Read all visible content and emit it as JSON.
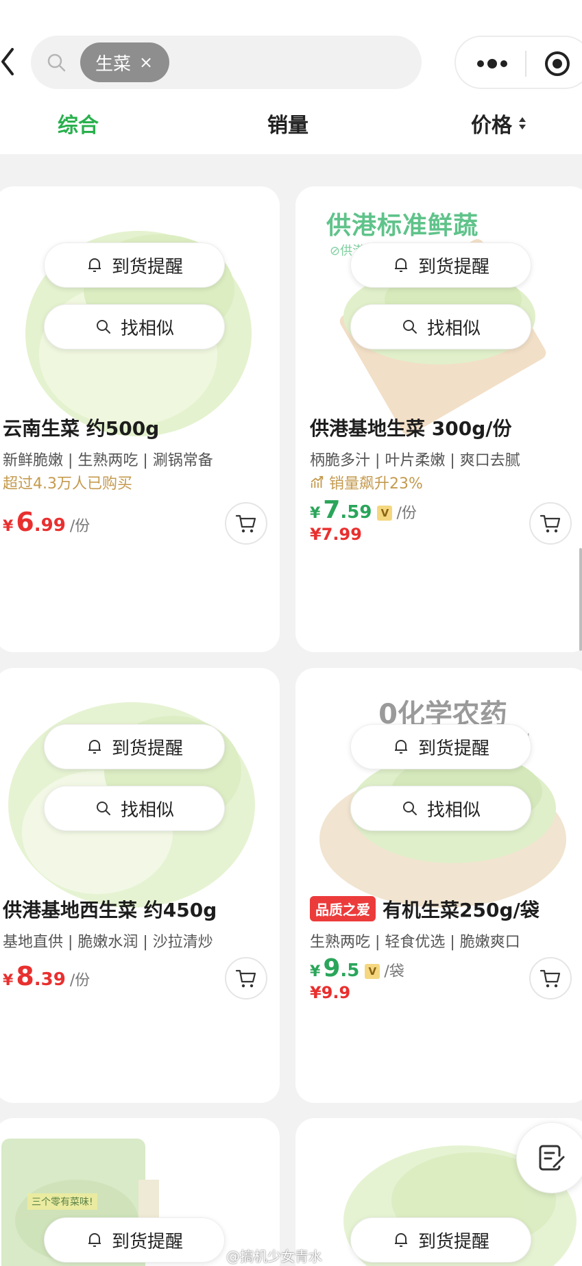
{
  "search": {
    "chip_label": "生菜",
    "chip_close": "×"
  },
  "tabs": {
    "comprehensive": "综合",
    "sales": "销量",
    "price": "价格"
  },
  "cards": [
    {
      "title": "云南生菜 约500g",
      "desc": "新鲜脆嫩 | 生熟两吃 | 涮锅常备",
      "promo": "超过4.3万人已购买",
      "price_int": "6",
      "price_dec": ".99",
      "unit": "/份",
      "notify": "到货提醒",
      "similar": "找相似"
    },
    {
      "banner_title": "供港标准鲜蔬",
      "banner_sub": "⊘供港标准 ⊘农残监控 ⊘食安保障",
      "title": "供港基地生菜 300g/份",
      "desc": "柄脆多汁 | 叶片柔嫩 | 爽口去腻",
      "promo": "销量飙升23%",
      "vip_price_int": "7",
      "vip_price_dec": ".59",
      "vip_badge": "V",
      "unit": "/份",
      "orig_price": "¥7.99",
      "notify": "到货提醒",
      "similar": "找相似"
    },
    {
      "title": "供港基地西生菜 约450g",
      "desc": "基地直供 | 脆嫩水润 | 沙拉清炒",
      "price_int": "8",
      "price_dec": ".39",
      "unit": "/份",
      "notify": "到货提醒",
      "similar": "找相似"
    },
    {
      "banner_big": "0化学农药",
      "banner_small": "种植过程不使用化学农药和化学肥料",
      "tag": "品质之爱",
      "title": "有机生菜250g/袋",
      "desc": "生熟两吃 | 轻食优选 | 脆嫩爽口",
      "vip_price_int": "9",
      "vip_price_dec": ".5",
      "vip_badge": "V",
      "unit": "/袋",
      "orig_price": "¥9.9",
      "notify": "到货提醒",
      "similar": "找相似"
    },
    {
      "notify": "到货提醒",
      "package_text": "三个零有菜味!"
    },
    {
      "notify": "到货提醒"
    }
  ],
  "currency": "¥",
  "watermark": "@搞机少女青水",
  "colors": {
    "accent_green": "#29b04d",
    "price_red": "#e8302f",
    "vip_green": "#2aa55a",
    "promo_gold": "#c49a4e"
  }
}
